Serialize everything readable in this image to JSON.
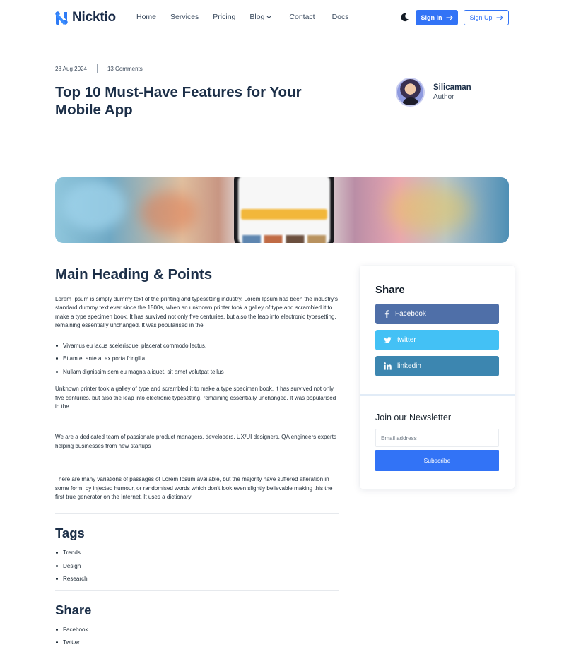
{
  "brand": {
    "name": "Nicktio",
    "accent": "#3273f6"
  },
  "nav": {
    "items": [
      {
        "label": "Home"
      },
      {
        "label": "Services"
      },
      {
        "label": "Pricing"
      },
      {
        "label": "Blog"
      },
      {
        "label": "Contact"
      },
      {
        "label": "Docs"
      }
    ],
    "theme_icon": "moon-icon",
    "sign_in": "Sign In",
    "sign_up": "Sign Up"
  },
  "post": {
    "date": "28 Aug 2024",
    "comments": "13 Comments",
    "title": "Top 10 Must-Have Features for Your Mobile App",
    "author_name": "Silicaman",
    "author_role": "Author"
  },
  "article": {
    "heading": "Main Heading & Points",
    "intro": "Lorem Ipsum is simply dummy text of the printing and typesetting industry. Lorem Ipsum has been the industry's standard dummy text ever since the 1500s, when an unknown printer took a galley of type and scrambled it to make a type specimen book. It has survived not only five centuries, but also the leap into electronic typesetting, remaining essentially unchanged. It was popularised in the",
    "points": [
      "Vivamus eu lacus scelerisque, placerat commodo lectus.",
      "Etiam et ante at ex porta fringilla.",
      "Nullam dignissim sem eu magna aliquet, sit amet volutpat tellus"
    ],
    "para2": "Unknown printer took a galley of type and scrambled it to make a type specimen book. It has survived not only five centuries, but also the leap into electronic typesetting, remaining essentially unchanged. It was popularised in the",
    "para3": "We are a dedicated team of passionate product managers, developers, UX/UI designers, QA engineers experts helping businesses from new startups",
    "para4": "There are many variations of passages of Lorem Ipsum available, but the majority have suffered alteration in some form, by injected humour, or randomised words which don't look even slightly believable making this the first true generator on the Internet. It uses a dictionary",
    "tags_heading": "Tags",
    "tags": [
      "Trends",
      "Design",
      "Research"
    ],
    "share_heading": "Share",
    "share_links": [
      "Facebook",
      "Twitter"
    ]
  },
  "sidebar": {
    "share_title": "Share",
    "share_buttons": [
      {
        "label": "Facebook",
        "icon": "facebook-icon",
        "color": "#4f6fa8"
      },
      {
        "label": "twitter",
        "icon": "twitter-icon",
        "color": "#43c1f5"
      },
      {
        "label": "linkedin",
        "icon": "linkedin-icon",
        "color": "#3c86b0"
      }
    ],
    "newsletter_title": "Join our Newsletter",
    "email_placeholder": "Email address",
    "subscribe_label": "Subscribe"
  }
}
